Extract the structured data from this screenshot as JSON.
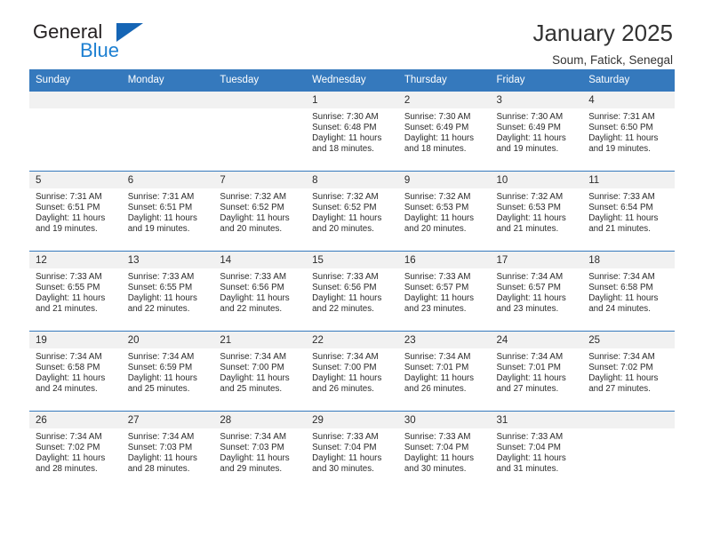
{
  "brand": {
    "name_part1": "General",
    "name_part2": "Blue",
    "triangle_color": "#1565b5",
    "blue_text_color": "#1c7fd1"
  },
  "header": {
    "title": "January 2025",
    "subtitle": "Soum, Fatick, Senegal",
    "header_row_color": "#3579bd"
  },
  "weekdays": [
    "Sunday",
    "Monday",
    "Tuesday",
    "Wednesday",
    "Thursday",
    "Friday",
    "Saturday"
  ],
  "weeks": [
    [
      {
        "day": "",
        "blank": true
      },
      {
        "day": "",
        "blank": true
      },
      {
        "day": "",
        "blank": true
      },
      {
        "day": "1",
        "sunrise": "Sunrise: 7:30 AM",
        "sunset": "Sunset: 6:48 PM",
        "daylight1": "Daylight: 11 hours",
        "daylight2": "and 18 minutes."
      },
      {
        "day": "2",
        "sunrise": "Sunrise: 7:30 AM",
        "sunset": "Sunset: 6:49 PM",
        "daylight1": "Daylight: 11 hours",
        "daylight2": "and 18 minutes."
      },
      {
        "day": "3",
        "sunrise": "Sunrise: 7:30 AM",
        "sunset": "Sunset: 6:49 PM",
        "daylight1": "Daylight: 11 hours",
        "daylight2": "and 19 minutes."
      },
      {
        "day": "4",
        "sunrise": "Sunrise: 7:31 AM",
        "sunset": "Sunset: 6:50 PM",
        "daylight1": "Daylight: 11 hours",
        "daylight2": "and 19 minutes."
      }
    ],
    [
      {
        "day": "5",
        "sunrise": "Sunrise: 7:31 AM",
        "sunset": "Sunset: 6:51 PM",
        "daylight1": "Daylight: 11 hours",
        "daylight2": "and 19 minutes."
      },
      {
        "day": "6",
        "sunrise": "Sunrise: 7:31 AM",
        "sunset": "Sunset: 6:51 PM",
        "daylight1": "Daylight: 11 hours",
        "daylight2": "and 19 minutes."
      },
      {
        "day": "7",
        "sunrise": "Sunrise: 7:32 AM",
        "sunset": "Sunset: 6:52 PM",
        "daylight1": "Daylight: 11 hours",
        "daylight2": "and 20 minutes."
      },
      {
        "day": "8",
        "sunrise": "Sunrise: 7:32 AM",
        "sunset": "Sunset: 6:52 PM",
        "daylight1": "Daylight: 11 hours",
        "daylight2": "and 20 minutes."
      },
      {
        "day": "9",
        "sunrise": "Sunrise: 7:32 AM",
        "sunset": "Sunset: 6:53 PM",
        "daylight1": "Daylight: 11 hours",
        "daylight2": "and 20 minutes."
      },
      {
        "day": "10",
        "sunrise": "Sunrise: 7:32 AM",
        "sunset": "Sunset: 6:53 PM",
        "daylight1": "Daylight: 11 hours",
        "daylight2": "and 21 minutes."
      },
      {
        "day": "11",
        "sunrise": "Sunrise: 7:33 AM",
        "sunset": "Sunset: 6:54 PM",
        "daylight1": "Daylight: 11 hours",
        "daylight2": "and 21 minutes."
      }
    ],
    [
      {
        "day": "12",
        "sunrise": "Sunrise: 7:33 AM",
        "sunset": "Sunset: 6:55 PM",
        "daylight1": "Daylight: 11 hours",
        "daylight2": "and 21 minutes."
      },
      {
        "day": "13",
        "sunrise": "Sunrise: 7:33 AM",
        "sunset": "Sunset: 6:55 PM",
        "daylight1": "Daylight: 11 hours",
        "daylight2": "and 22 minutes."
      },
      {
        "day": "14",
        "sunrise": "Sunrise: 7:33 AM",
        "sunset": "Sunset: 6:56 PM",
        "daylight1": "Daylight: 11 hours",
        "daylight2": "and 22 minutes."
      },
      {
        "day": "15",
        "sunrise": "Sunrise: 7:33 AM",
        "sunset": "Sunset: 6:56 PM",
        "daylight1": "Daylight: 11 hours",
        "daylight2": "and 22 minutes."
      },
      {
        "day": "16",
        "sunrise": "Sunrise: 7:33 AM",
        "sunset": "Sunset: 6:57 PM",
        "daylight1": "Daylight: 11 hours",
        "daylight2": "and 23 minutes."
      },
      {
        "day": "17",
        "sunrise": "Sunrise: 7:34 AM",
        "sunset": "Sunset: 6:57 PM",
        "daylight1": "Daylight: 11 hours",
        "daylight2": "and 23 minutes."
      },
      {
        "day": "18",
        "sunrise": "Sunrise: 7:34 AM",
        "sunset": "Sunset: 6:58 PM",
        "daylight1": "Daylight: 11 hours",
        "daylight2": "and 24 minutes."
      }
    ],
    [
      {
        "day": "19",
        "sunrise": "Sunrise: 7:34 AM",
        "sunset": "Sunset: 6:58 PM",
        "daylight1": "Daylight: 11 hours",
        "daylight2": "and 24 minutes."
      },
      {
        "day": "20",
        "sunrise": "Sunrise: 7:34 AM",
        "sunset": "Sunset: 6:59 PM",
        "daylight1": "Daylight: 11 hours",
        "daylight2": "and 25 minutes."
      },
      {
        "day": "21",
        "sunrise": "Sunrise: 7:34 AM",
        "sunset": "Sunset: 7:00 PM",
        "daylight1": "Daylight: 11 hours",
        "daylight2": "and 25 minutes."
      },
      {
        "day": "22",
        "sunrise": "Sunrise: 7:34 AM",
        "sunset": "Sunset: 7:00 PM",
        "daylight1": "Daylight: 11 hours",
        "daylight2": "and 26 minutes."
      },
      {
        "day": "23",
        "sunrise": "Sunrise: 7:34 AM",
        "sunset": "Sunset: 7:01 PM",
        "daylight1": "Daylight: 11 hours",
        "daylight2": "and 26 minutes."
      },
      {
        "day": "24",
        "sunrise": "Sunrise: 7:34 AM",
        "sunset": "Sunset: 7:01 PM",
        "daylight1": "Daylight: 11 hours",
        "daylight2": "and 27 minutes."
      },
      {
        "day": "25",
        "sunrise": "Sunrise: 7:34 AM",
        "sunset": "Sunset: 7:02 PM",
        "daylight1": "Daylight: 11 hours",
        "daylight2": "and 27 minutes."
      }
    ],
    [
      {
        "day": "26",
        "sunrise": "Sunrise: 7:34 AM",
        "sunset": "Sunset: 7:02 PM",
        "daylight1": "Daylight: 11 hours",
        "daylight2": "and 28 minutes."
      },
      {
        "day": "27",
        "sunrise": "Sunrise: 7:34 AM",
        "sunset": "Sunset: 7:03 PM",
        "daylight1": "Daylight: 11 hours",
        "daylight2": "and 28 minutes."
      },
      {
        "day": "28",
        "sunrise": "Sunrise: 7:34 AM",
        "sunset": "Sunset: 7:03 PM",
        "daylight1": "Daylight: 11 hours",
        "daylight2": "and 29 minutes."
      },
      {
        "day": "29",
        "sunrise": "Sunrise: 7:33 AM",
        "sunset": "Sunset: 7:04 PM",
        "daylight1": "Daylight: 11 hours",
        "daylight2": "and 30 minutes."
      },
      {
        "day": "30",
        "sunrise": "Sunrise: 7:33 AM",
        "sunset": "Sunset: 7:04 PM",
        "daylight1": "Daylight: 11 hours",
        "daylight2": "and 30 minutes."
      },
      {
        "day": "31",
        "sunrise": "Sunrise: 7:33 AM",
        "sunset": "Sunset: 7:04 PM",
        "daylight1": "Daylight: 11 hours",
        "daylight2": "and 31 minutes."
      },
      {
        "day": "",
        "blank": true
      }
    ]
  ]
}
